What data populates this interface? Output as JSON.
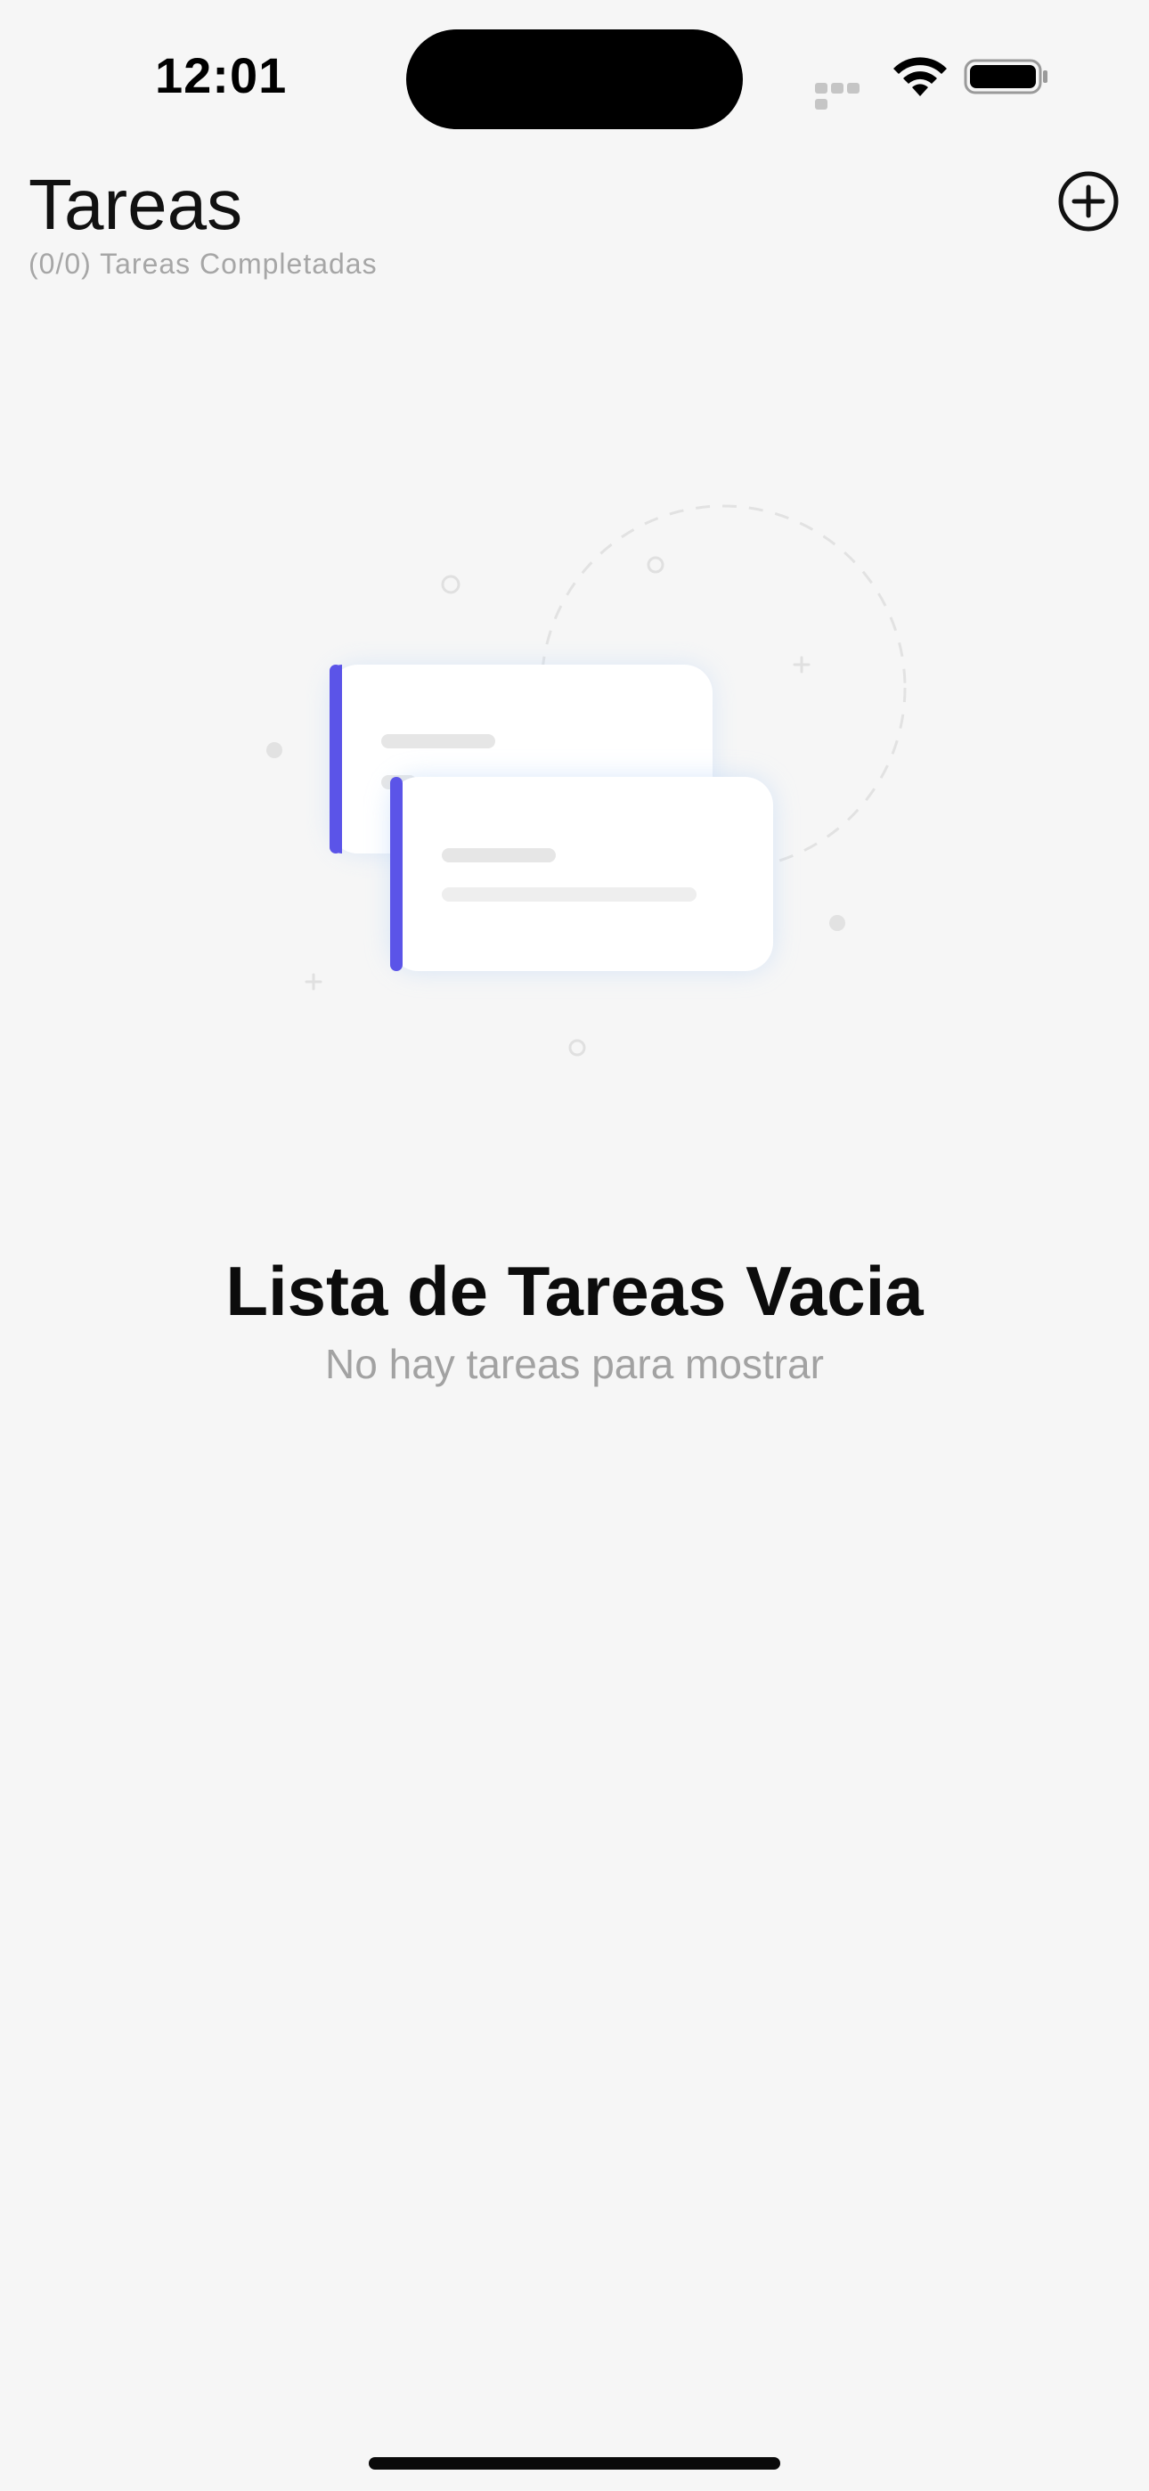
{
  "status_bar": {
    "time": "12:01",
    "icons": [
      "cellular-signal-icon",
      "wifi-icon",
      "battery-icon"
    ]
  },
  "header": {
    "title": "Tareas",
    "subtitle": "(0/0) Tareas Completadas",
    "add_icon": "plus-circle-icon"
  },
  "empty_state": {
    "title": "Lista de Tareas Vacia",
    "message": "No hay tareas para mostrar"
  },
  "colors": {
    "background": "#f6f6f6",
    "accent": "#5b54e8",
    "card": "#ffffff",
    "placeholder_line": "#e6e6e6"
  }
}
